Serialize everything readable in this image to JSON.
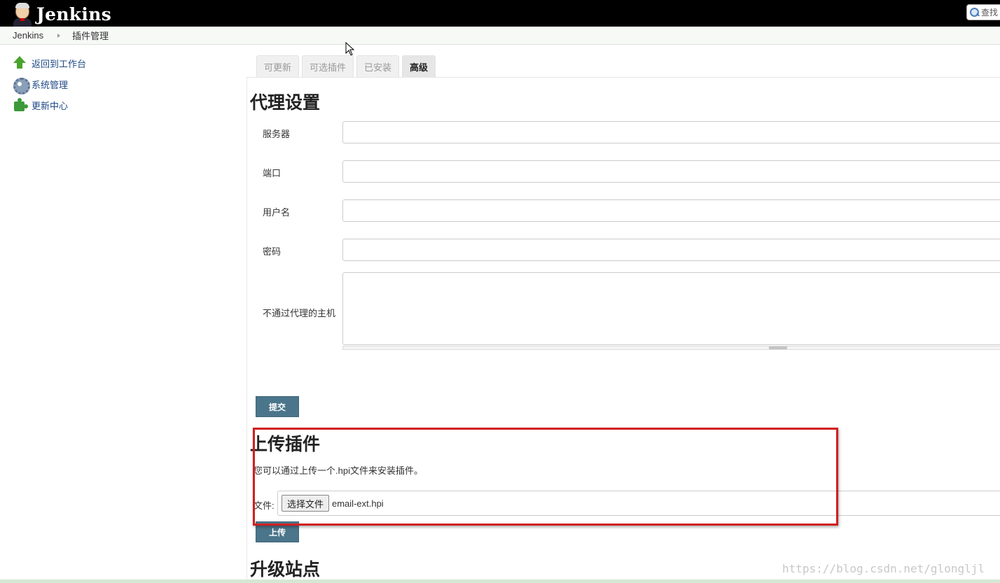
{
  "header": {
    "app_name": "Jenkins",
    "search_label": "查找"
  },
  "breadcrumb": {
    "items": [
      "Jenkins",
      "插件管理"
    ]
  },
  "sidebar": {
    "items": [
      {
        "label": "返回到工作台",
        "icon": "up-arrow-icon"
      },
      {
        "label": "系统管理",
        "icon": "gear-icon"
      },
      {
        "label": "更新中心",
        "icon": "puzzle-icon"
      }
    ]
  },
  "tabs": [
    {
      "label": "可更新",
      "active": false
    },
    {
      "label": "可选插件",
      "active": false
    },
    {
      "label": "已安装",
      "active": false
    },
    {
      "label": "高级",
      "active": true
    }
  ],
  "proxy": {
    "title": "代理设置",
    "fields": [
      {
        "label": "服务器",
        "value": ""
      },
      {
        "label": "端口",
        "value": ""
      },
      {
        "label": "用户名",
        "value": ""
      },
      {
        "label": "密码",
        "value": ""
      }
    ],
    "no_proxy_label": "不通过代理的主机",
    "no_proxy_value": "",
    "submit_label": "提交"
  },
  "upload": {
    "title": "上传插件",
    "description": "您可以通过上传一个.hpi文件来安装插件。",
    "file_label": "文件:",
    "choose_label": "选择文件",
    "file_name": "email-ext.hpi",
    "upload_label": "上传"
  },
  "update_site": {
    "title": "升级站点"
  },
  "watermark": "https://blog.csdn.net/glongljl",
  "colors": {
    "topbar": "#000000",
    "button": "#4b758b",
    "highlight": "#d01f1f",
    "link": "#204a87"
  }
}
